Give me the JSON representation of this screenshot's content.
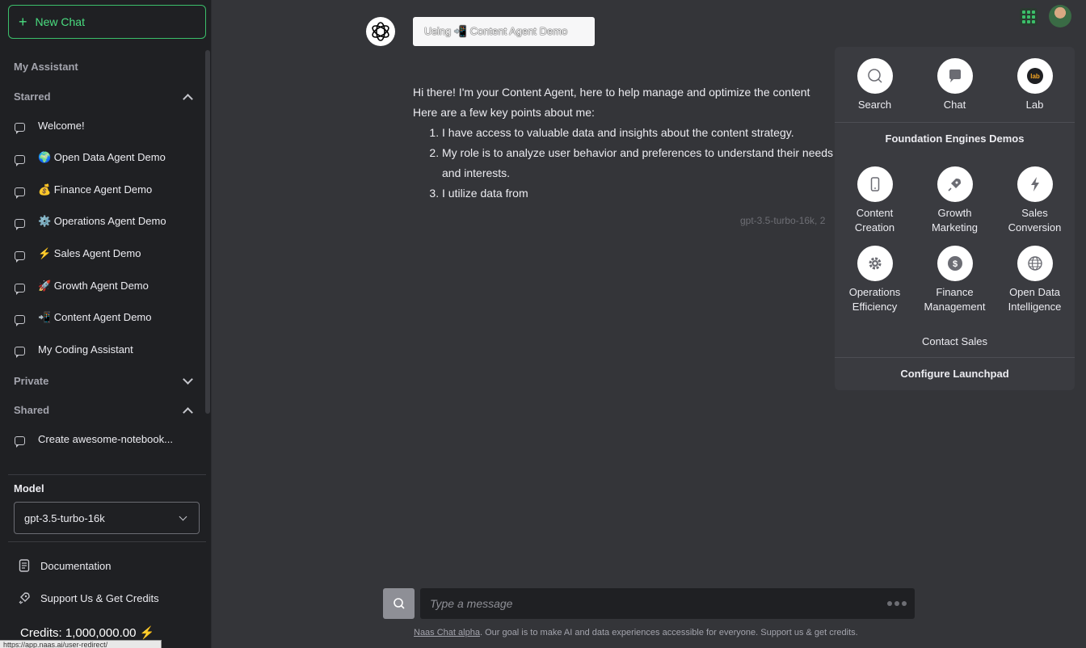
{
  "sidebar": {
    "new_chat": "New Chat",
    "my_assistant": "My Assistant",
    "starred": {
      "title": "Starred",
      "items": [
        "Welcome!",
        "🌍 Open Data Agent Demo",
        "💰 Finance Agent Demo",
        "⚙️ Operations Agent Demo",
        "⚡ Sales Agent Demo",
        "🚀 Growth Agent Demo",
        "📲 Content Agent Demo",
        "My Coding Assistant"
      ]
    },
    "private": {
      "title": "Private"
    },
    "shared": {
      "title": "Shared",
      "items": [
        "Create awesome-notebook..."
      ]
    },
    "model_label": "Model",
    "model_value": "gpt-3.5-turbo-16k",
    "documentation": "Documentation",
    "support": "Support Us & Get Credits",
    "credits": "Credits: 1,000,000.00 ⚡",
    "status_url": "https://app.naas.ai/user-redirect/"
  },
  "chat": {
    "using_label": "Using 📲 Content Agent Demo",
    "message_intro": "Hi there! I'm your Content Agent, here to help manage and optimize the content",
    "message_line2": "Here are a few key points about me:",
    "points": [
      "I have access to valuable data and insights about the content strategy.",
      "My role is to analyze user behavior and preferences to understand their needs and interests.",
      "I utilize data from"
    ],
    "meta": "gpt-3.5-turbo-16k, 2",
    "input_placeholder": "Type a message",
    "footer_link": "Naas Chat alpha",
    "footer_text": ". Our goal is to make AI and data experiences accessible for everyone. Support us & get credits."
  },
  "launchpad": {
    "top_items": [
      {
        "label": "Search",
        "icon": "search-icon"
      },
      {
        "label": "Chat",
        "icon": "chat-icon"
      },
      {
        "label": "Lab",
        "icon": "lab-icon"
      }
    ],
    "heading": "Foundation Engines Demos",
    "demos": [
      {
        "line1": "Content",
        "line2": "Creation",
        "icon": "smartphone-icon"
      },
      {
        "line1": "Growth",
        "line2": "Marketing",
        "icon": "rocket-icon"
      },
      {
        "line1": "Sales",
        "line2": "Conversion",
        "icon": "lightning-icon"
      },
      {
        "line1": "Operations",
        "line2": "Efficiency",
        "icon": "gear-icon"
      },
      {
        "line1": "Finance",
        "line2": "Management",
        "icon": "dollar-icon"
      },
      {
        "line1": "Open Data",
        "line2": "Intelligence",
        "icon": "globe-icon"
      }
    ],
    "contact_sales": "Contact Sales",
    "configure": "Configure Launchpad"
  },
  "colors": {
    "accent": "#4ade80",
    "sidebar_bg": "#1f2023",
    "main_bg": "#343539",
    "popover_bg": "#3a3b40"
  }
}
